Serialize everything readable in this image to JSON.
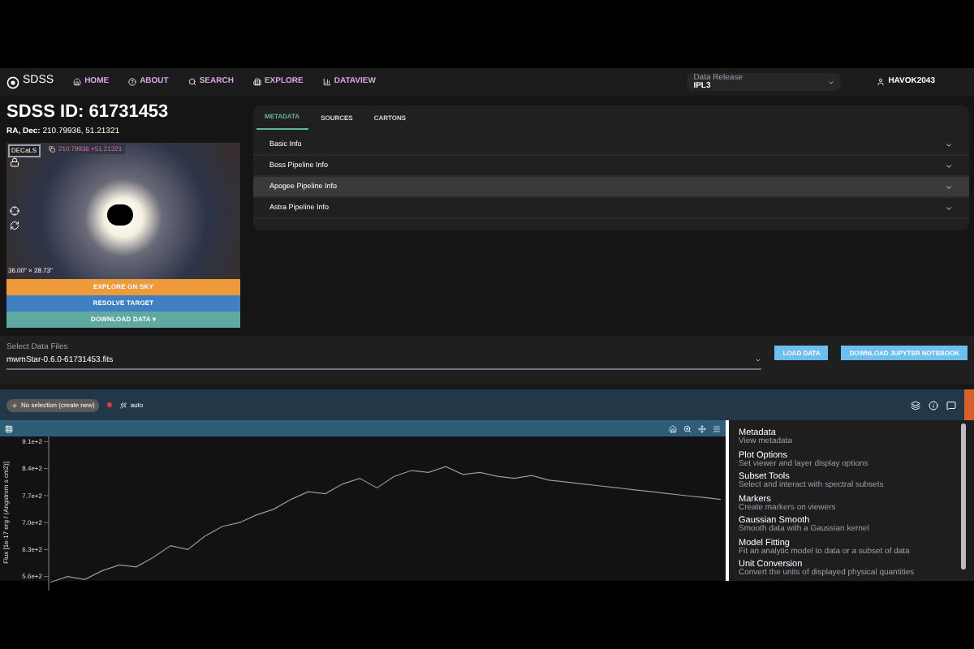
{
  "nav": {
    "logo": "SDSS",
    "links": [
      "HOME",
      "ABOUT",
      "SEARCH",
      "EXPLORE",
      "DATAVIEW"
    ],
    "release_label": "Data Release",
    "release_value": "IPL3",
    "user": "HAVOK2043"
  },
  "target": {
    "title": "SDSS ID: 61731453",
    "coords_label": "RA, Dec:",
    "coords": "210.79936, 51.21321",
    "survey": "DECaLS",
    "image_coords": "210.79936 +51.21321",
    "fov": "36.00\" × 28.73\"",
    "buttons": [
      {
        "label": "EXPLORE ON SKY",
        "kind": "orange"
      },
      {
        "label": "RESOLVE TARGET",
        "kind": "blue"
      },
      {
        "label": "DOWNLOAD DATA ▾",
        "kind": "teal"
      }
    ]
  },
  "tabs": [
    {
      "label": "METADATA",
      "selected": true
    },
    {
      "label": "SOURCES",
      "selected": false
    },
    {
      "label": "CARTONS",
      "selected": false
    }
  ],
  "sections": [
    {
      "label": "Basic Info",
      "selected": false
    },
    {
      "label": "Boss Pipeline Info",
      "selected": false
    },
    {
      "label": "Apogee Pipeline Info",
      "selected": true
    },
    {
      "label": "Astra Pipeline Info",
      "selected": false
    }
  ],
  "files": {
    "label": "Select Data Files",
    "value": "mwmStar-0.6.0-61731453.fits",
    "buttons": [
      "LOAD DATA",
      "DOWNLOAD JUPYTER NOTEBOOK"
    ]
  },
  "viewer": {
    "subset": "No selection (create new)",
    "mode": "auto",
    "chart_data": {
      "type": "line",
      "x": [
        null,
        null,
        null,
        null,
        null,
        null,
        null,
        null,
        null,
        null,
        null,
        null,
        null,
        null,
        null,
        null,
        null,
        null,
        null,
        null,
        null,
        null,
        null,
        null,
        null,
        null,
        null,
        null,
        null,
        null,
        null,
        null,
        null,
        null,
        null,
        null,
        null,
        null,
        null,
        null
      ],
      "ylabel": "Flux [1e-17 erg / (Angstrom s cm2)]",
      "ylim": [
        532,
        915
      ],
      "yticks": [
        {
          "value": 910,
          "label": "9.1e+2"
        },
        {
          "value": 840,
          "label": "8.4e+2"
        },
        {
          "value": 770,
          "label": "7.7e+2"
        },
        {
          "value": 700,
          "label": "7.0e+2"
        },
        {
          "value": 630,
          "label": "6.3e+2"
        },
        {
          "value": 560,
          "label": "5.6e+2"
        }
      ],
      "series": [
        {
          "color": "#9a9a9a",
          "values": [
            545,
            560,
            552,
            575,
            590,
            585,
            610,
            640,
            630,
            665,
            690,
            700,
            720,
            735,
            760,
            780,
            775,
            800,
            815,
            790,
            820,
            835,
            830,
            845,
            825,
            830,
            820,
            815,
            822,
            810,
            805,
            800,
            795,
            790,
            785,
            780,
            775,
            770,
            765,
            760
          ]
        }
      ]
    }
  },
  "plugins": [
    {
      "name": "Metadata",
      "desc": "View metadata"
    },
    {
      "name": "Plot Options",
      "desc": "Set viewer and layer display options"
    },
    {
      "name": "Subset Tools",
      "desc": "Select and interact with spectral subsets"
    },
    {
      "name": "Markers",
      "desc": "Create markers on viewers"
    },
    {
      "name": "Gaussian Smooth",
      "desc": "Smooth data with a Gaussian kernel"
    },
    {
      "name": "Model Fitting",
      "desc": "Fit an analytic model to data or a subset of data"
    },
    {
      "name": "Unit Conversion",
      "desc": "Convert the units of displayed physical quantities"
    }
  ]
}
